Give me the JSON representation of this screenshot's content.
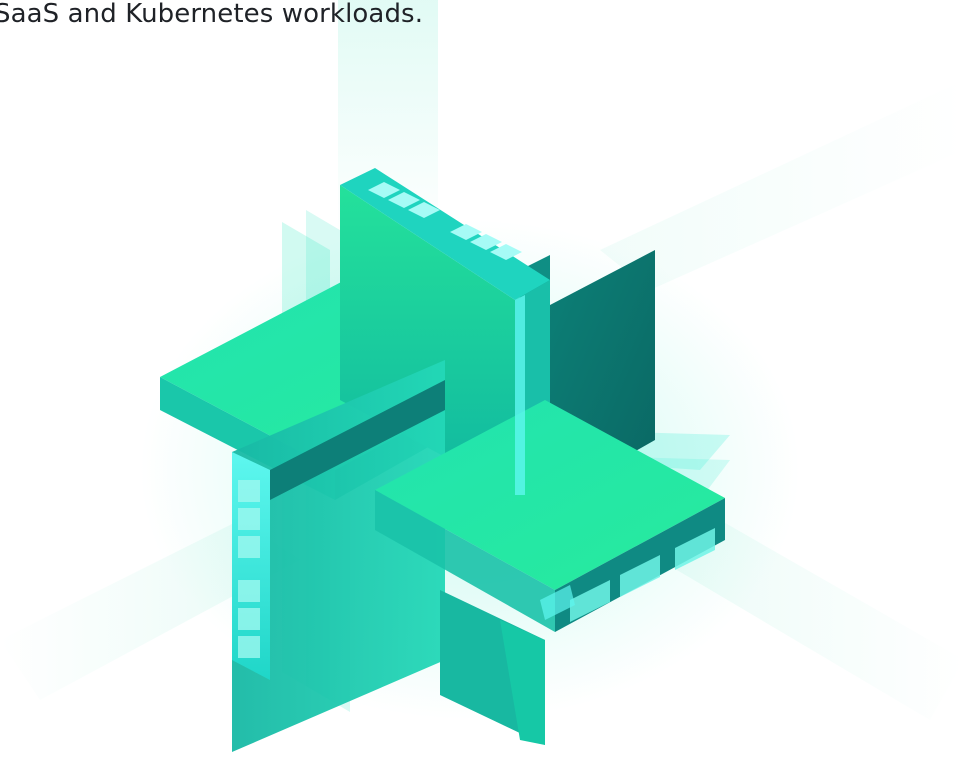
{
  "intro": {
    "text_line": "SaaS and Kubernetes workloads."
  },
  "hero": {
    "illustration_icon": "isometric-stacked-server-blocks-icon",
    "colors": {
      "teal": "#1fe0b0",
      "green": "#2ee890",
      "cyan": "#38f4e6",
      "deep_teal": "#0e8f82",
      "shadow_teal": "#0a6e6a"
    }
  }
}
